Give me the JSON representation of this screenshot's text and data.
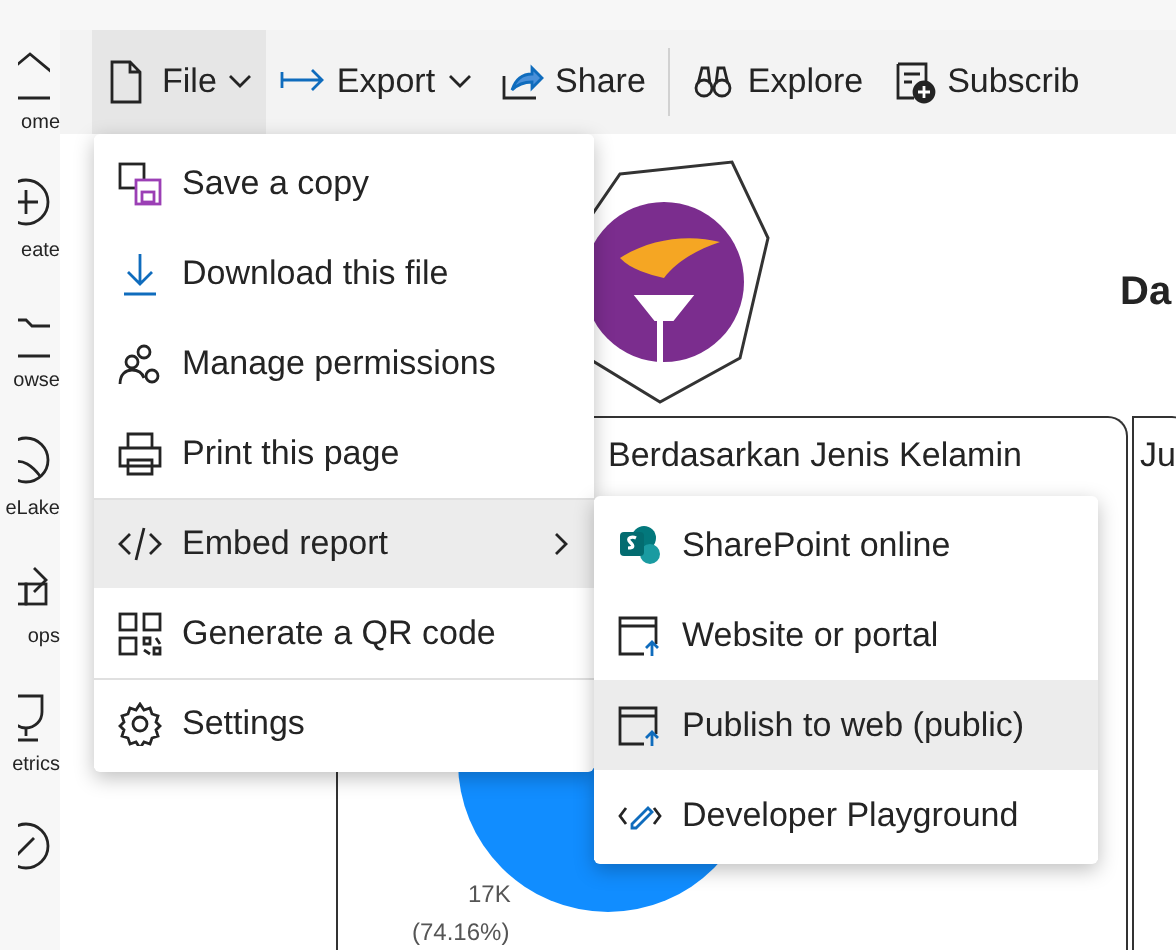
{
  "nav_rail": [
    {
      "label": "ome"
    },
    {
      "label": "eate"
    },
    {
      "label": "owse"
    },
    {
      "label": "eLake"
    },
    {
      "label": "ops"
    },
    {
      "label": "etrics"
    }
  ],
  "toolbar": [
    {
      "label": "File",
      "kind": "dropdown",
      "selected": true
    },
    {
      "label": "Export",
      "kind": "dropdown",
      "selected": false
    },
    {
      "label": "Share",
      "kind": "button",
      "selected": false
    },
    {
      "label": "Explore",
      "kind": "button",
      "selected": false
    },
    {
      "label": "Subscrib",
      "kind": "button",
      "selected": false
    }
  ],
  "file_menu": [
    {
      "label": "Save a copy",
      "selected": false,
      "submenu": false,
      "divider_above": false
    },
    {
      "label": "Download this file",
      "selected": false,
      "submenu": false,
      "divider_above": false
    },
    {
      "label": "Manage permissions",
      "selected": false,
      "submenu": false,
      "divider_above": false
    },
    {
      "label": "Print this page",
      "selected": false,
      "submenu": false,
      "divider_above": false
    },
    {
      "label": "Embed report",
      "selected": true,
      "submenu": true,
      "divider_above": true
    },
    {
      "label": "Generate a QR code",
      "selected": false,
      "submenu": false,
      "divider_above": false
    },
    {
      "label": "Settings",
      "selected": false,
      "submenu": false,
      "divider_above": true
    }
  ],
  "embed_submenu": [
    {
      "label": "SharePoint online",
      "selected": false
    },
    {
      "label": "Website or portal",
      "selected": false
    },
    {
      "label": "Publish to web (public)",
      "selected": true
    },
    {
      "label": "Developer Playground",
      "selected": false
    }
  ],
  "report": {
    "title": "Da",
    "visuals": [
      {
        "title": "Berdasarkan Jenis Kelamin",
        "data_labels": [
          "17K",
          "(74.16%)"
        ]
      },
      {
        "title": "Ju"
      }
    ]
  }
}
